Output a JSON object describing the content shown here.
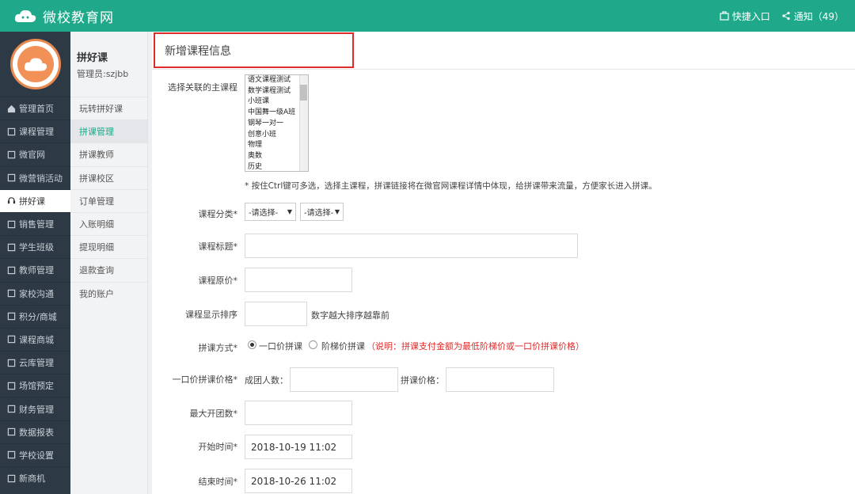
{
  "app": {
    "brand": "微校教育网",
    "quick_entry": "快捷入口",
    "notify": "通知（49）"
  },
  "sidebar": {
    "items": [
      {
        "label": "管理首页",
        "icon": "home-icon"
      },
      {
        "label": "课程管理",
        "icon": "course-icon"
      },
      {
        "label": "微官网",
        "icon": "site-icon"
      },
      {
        "label": "微营销活动",
        "icon": "marketing-icon"
      },
      {
        "label": "拼好课",
        "icon": "headset-icon"
      },
      {
        "label": "销售管理",
        "icon": "sales-icon"
      },
      {
        "label": "学生班级",
        "icon": "class-icon"
      },
      {
        "label": "教师管理",
        "icon": "teacher-icon"
      },
      {
        "label": "家校沟通",
        "icon": "chat-icon"
      },
      {
        "label": "积分/商城",
        "icon": "points-icon"
      },
      {
        "label": "课程商城",
        "icon": "mall-icon"
      },
      {
        "label": "云库管理",
        "icon": "cloud-icon"
      },
      {
        "label": "场馆预定",
        "icon": "venue-icon"
      },
      {
        "label": "财务管理",
        "icon": "finance-icon"
      },
      {
        "label": "数据报表",
        "icon": "report-icon"
      },
      {
        "label": "学校设置",
        "icon": "settings-icon"
      },
      {
        "label": "新商机",
        "icon": "opportunity-icon"
      }
    ]
  },
  "submenu": {
    "title": "拼好课",
    "user": "管理员:szjbb",
    "items": [
      "玩转拼好课",
      "拼课管理",
      "拼课教师",
      "拼课校区",
      "订单管理",
      "入账明细",
      "提现明细",
      "退款查询",
      "我的账户"
    ]
  },
  "form": {
    "header": "新增课程信息",
    "main_course_label": "选择关联的主课程",
    "main_course_options": [
      "语文课程测试",
      "数学课程测试",
      "小班课",
      "中国舞一级A班",
      "钢琴一对一",
      "创意小班",
      "物理",
      "奥数",
      "历史"
    ],
    "hint": "* 按住Ctrl键可多选，选择主课程，拼课链接将在微官网课程详情中体现，给拼课带来流量，方便家长进入拼课。",
    "category_label": "课程分类*",
    "category_select1": "-请选择-",
    "category_select2": "-请选择-",
    "title_label": "课程标题*",
    "price_label": "课程原价*",
    "sort_label": "课程显示排序",
    "sort_note": "数字越大排序越靠前",
    "mode_label": "拼课方式*",
    "mode_option1": "一口价拼课",
    "mode_option2": "阶梯价拼课",
    "mode_note": "（说明：拼课支付金额为最低阶梯价或一口价拼课价格）",
    "fixed_label": "一口价拼课价格*",
    "group_people_label": "成团人数：",
    "group_price_label": "拼课价格：",
    "max_groups_label": "最大开团数*",
    "start_label": "开始时间*",
    "start_value": "2018-10-19 11:02",
    "end_label": "结束时间*",
    "end_value": "2018-10-26 11:02"
  }
}
